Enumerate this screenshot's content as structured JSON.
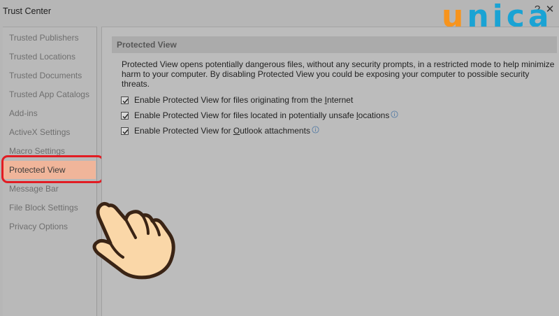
{
  "window": {
    "title": "Trust Center"
  },
  "logo": {
    "text_u": "u",
    "text_n": "n",
    "text_i": "i",
    "text_c": "c",
    "text_a": "a"
  },
  "sidebar": {
    "items": [
      {
        "label": "Trusted Publishers"
      },
      {
        "label": "Trusted Locations"
      },
      {
        "label": "Trusted Documents"
      },
      {
        "label": "Trusted App Catalogs"
      },
      {
        "label": "Add-ins"
      },
      {
        "label": "ActiveX Settings"
      },
      {
        "label": "Macro Settings"
      },
      {
        "label": "Protected View",
        "selected": true
      },
      {
        "label": "Message Bar"
      },
      {
        "label": "File Block Settings"
      },
      {
        "label": "Privacy Options"
      }
    ]
  },
  "main": {
    "section_title": "Protected View",
    "description": "Protected View opens potentially dangerous files, without any security prompts, in a restricted mode to help minimize harm to your computer. By disabling Protected View you could be exposing your computer to possible security threats.",
    "options": [
      {
        "pre": "Enable Protected View for files originating from the ",
        "key": "I",
        "post": "nternet",
        "checked": true,
        "info": false
      },
      {
        "pre": "Enable Protected View for files located in potentially unsafe ",
        "key": "l",
        "post": "ocations",
        "checked": true,
        "info": true
      },
      {
        "pre": "Enable Protected View for ",
        "key": "O",
        "post": "utlook attachments",
        "checked": true,
        "info": true
      }
    ]
  },
  "colors": {
    "selected_bg": "#f0b59a",
    "highlight_ring": "#e21c23",
    "logo_orange": "#f7941d",
    "logo_blue": "#1aa3d4"
  },
  "icons": {
    "window_controls": [
      "help-icon",
      "close-icon"
    ],
    "info": "info-icon",
    "pointer": "pointing-hand-icon"
  }
}
